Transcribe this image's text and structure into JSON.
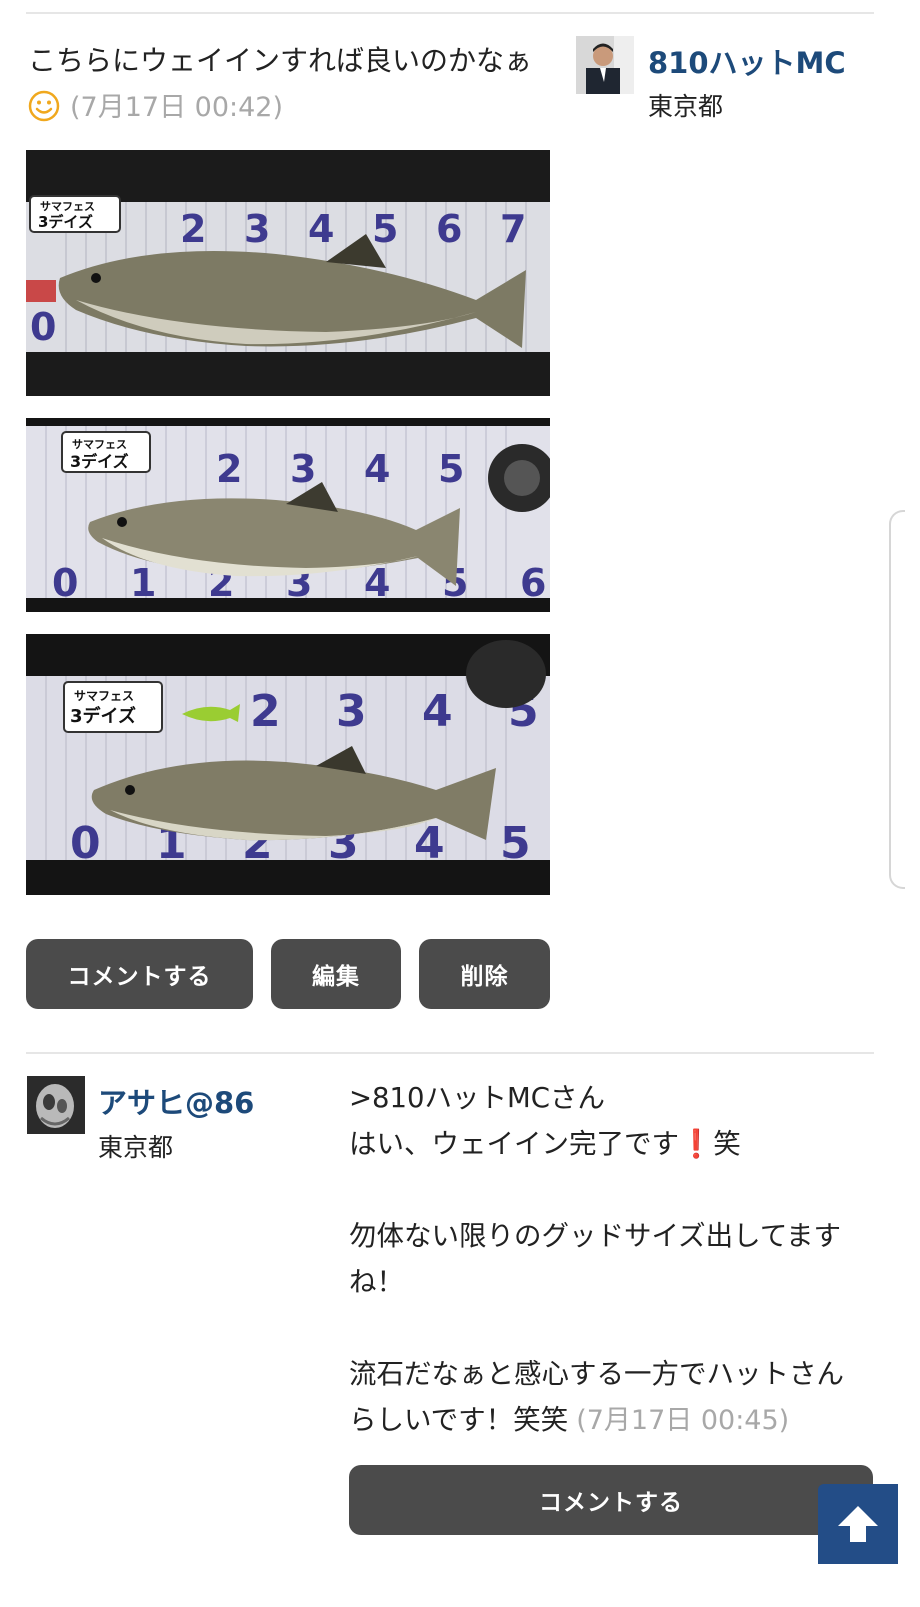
{
  "post": {
    "text": "こちらにウェイインすれば良いのかなぁ",
    "timestamp": "(7月17日 00:42)",
    "icon": "smiley-icon",
    "author": {
      "name": "810ハットMC",
      "location": "東京都"
    },
    "photos": [
      {
        "scale_label_line1": "サマフェス",
        "scale_label_line2": "3デイズ",
        "top_numbers": [
          "2",
          "3",
          "4",
          "5",
          "6",
          "7"
        ],
        "bottom_numbers": [
          "0"
        ]
      },
      {
        "scale_label_line1": "サマフェス",
        "scale_label_line2": "3デイズ",
        "top_numbers": [
          "2",
          "3",
          "4",
          "5"
        ],
        "bottom_numbers": [
          "0",
          "1",
          "2",
          "3",
          "4",
          "5",
          "6"
        ]
      },
      {
        "scale_label_line1": "サマフェス",
        "scale_label_line2": "3デイズ",
        "top_numbers": [
          "2",
          "3",
          "4",
          "5"
        ],
        "bottom_numbers": [
          "0",
          "1",
          "2",
          "3",
          "4",
          "5"
        ]
      }
    ],
    "buttons": {
      "comment": "コメントする",
      "edit": "編集",
      "delete": "削除"
    }
  },
  "reply": {
    "author": {
      "name": "アサヒ@86",
      "location": "東京都"
    },
    "line1": ">810ハットMCさん",
    "line2_pre": "はい、ウェイイン完了です",
    "line2_mark": "❗",
    "line2_post": "笑",
    "para2": "勿体ない限りのグッドサイズ出してますね！",
    "para3": "流石だなぁと感心する一方でハットさんらしいです！笑笑",
    "timestamp": "(7月17日 00:45)",
    "comment_button": "コメントする"
  },
  "colors": {
    "username": "#1d4a7a",
    "button_bg": "#4b4b4b",
    "scroll_top_bg": "#234d87",
    "timestamp": "#a8a8a8",
    "exclamation": "#e02020"
  },
  "scroll_top": {
    "icon": "arrow-up-icon"
  }
}
